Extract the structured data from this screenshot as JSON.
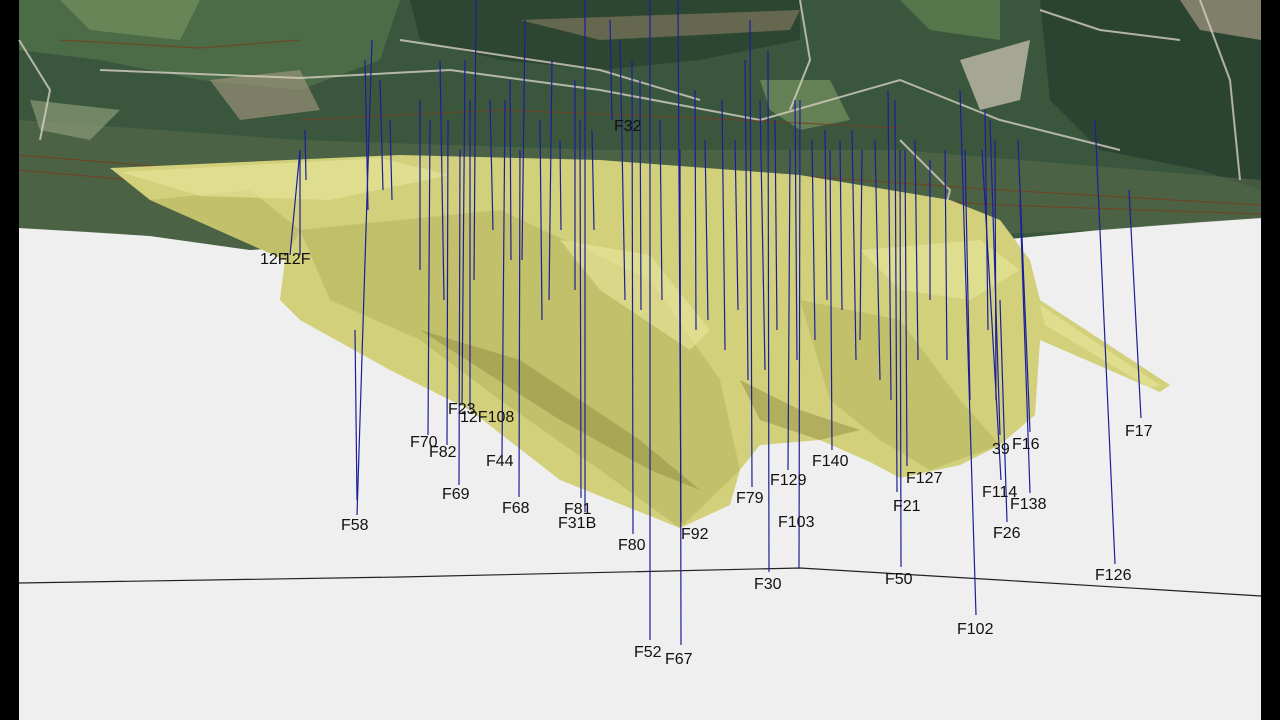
{
  "scene": {
    "background_color": "#efefef",
    "terrain_colors": [
      "#2f4a36",
      "#4f7048",
      "#6f8c5c",
      "#8a7d62",
      "#c9c2b0"
    ],
    "orebody_color": "#d2d07a",
    "drillhole_color": "#1b1f9a",
    "section_line_color": "#222222"
  },
  "drillholes": [
    {
      "label": "F32"
    },
    {
      "label": "12F"
    },
    {
      "label": "12F"
    },
    {
      "label": "F23"
    },
    {
      "label": "12F108"
    },
    {
      "label": "F70"
    },
    {
      "label": "F82"
    },
    {
      "label": "F44"
    },
    {
      "label": "F69"
    },
    {
      "label": "F68"
    },
    {
      "label": "F58"
    },
    {
      "label": "F81"
    },
    {
      "label": "F31B"
    },
    {
      "label": "F80"
    },
    {
      "label": "F92"
    },
    {
      "label": "F52"
    },
    {
      "label": "F67"
    },
    {
      "label": "F79"
    },
    {
      "label": "F129"
    },
    {
      "label": "F140"
    },
    {
      "label": "F103"
    },
    {
      "label": "F30"
    },
    {
      "label": "F127"
    },
    {
      "label": "F21"
    },
    {
      "label": "F50"
    },
    {
      "label": "39"
    },
    {
      "label": "F16"
    },
    {
      "label": "F114"
    },
    {
      "label": "F138"
    },
    {
      "label": "F26"
    },
    {
      "label": "F102"
    },
    {
      "label": "F126"
    },
    {
      "label": "F17"
    }
  ]
}
